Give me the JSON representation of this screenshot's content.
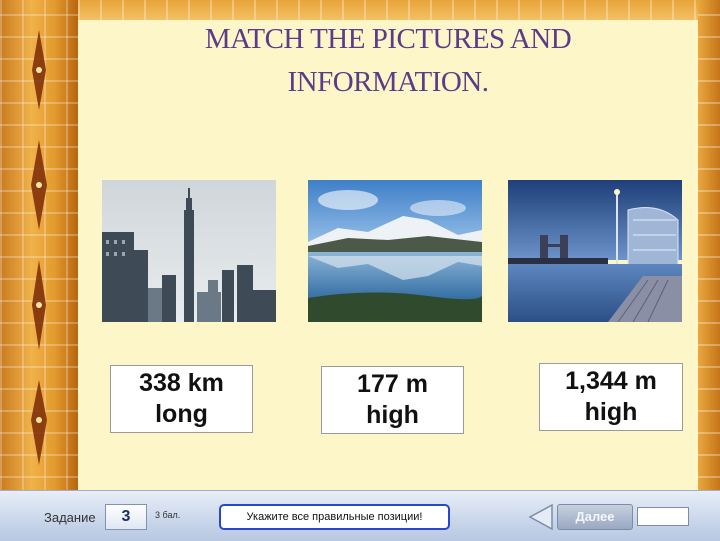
{
  "title": {
    "line1": "MATCH THE PICTURES AND",
    "line2": "INFORMATION."
  },
  "photos": [
    {
      "name": "city-skyline-photo"
    },
    {
      "name": "mountain-lake-photo"
    },
    {
      "name": "river-bridge-photo"
    }
  ],
  "labels": [
    {
      "line1": "338 km",
      "line2": "long"
    },
    {
      "line1": "177 m",
      "line2": "high"
    },
    {
      "line1": "1,344 m",
      "line2": "high"
    }
  ],
  "footer": {
    "task_label": "Задание",
    "task_number": "3",
    "points": "3 бал.",
    "hint": "Укажите все правильные позиции!",
    "next_label": "Далее"
  },
  "colors": {
    "title": "#5b3c8a",
    "frame": "#e39a2e",
    "hint_border": "#2b47c9"
  }
}
